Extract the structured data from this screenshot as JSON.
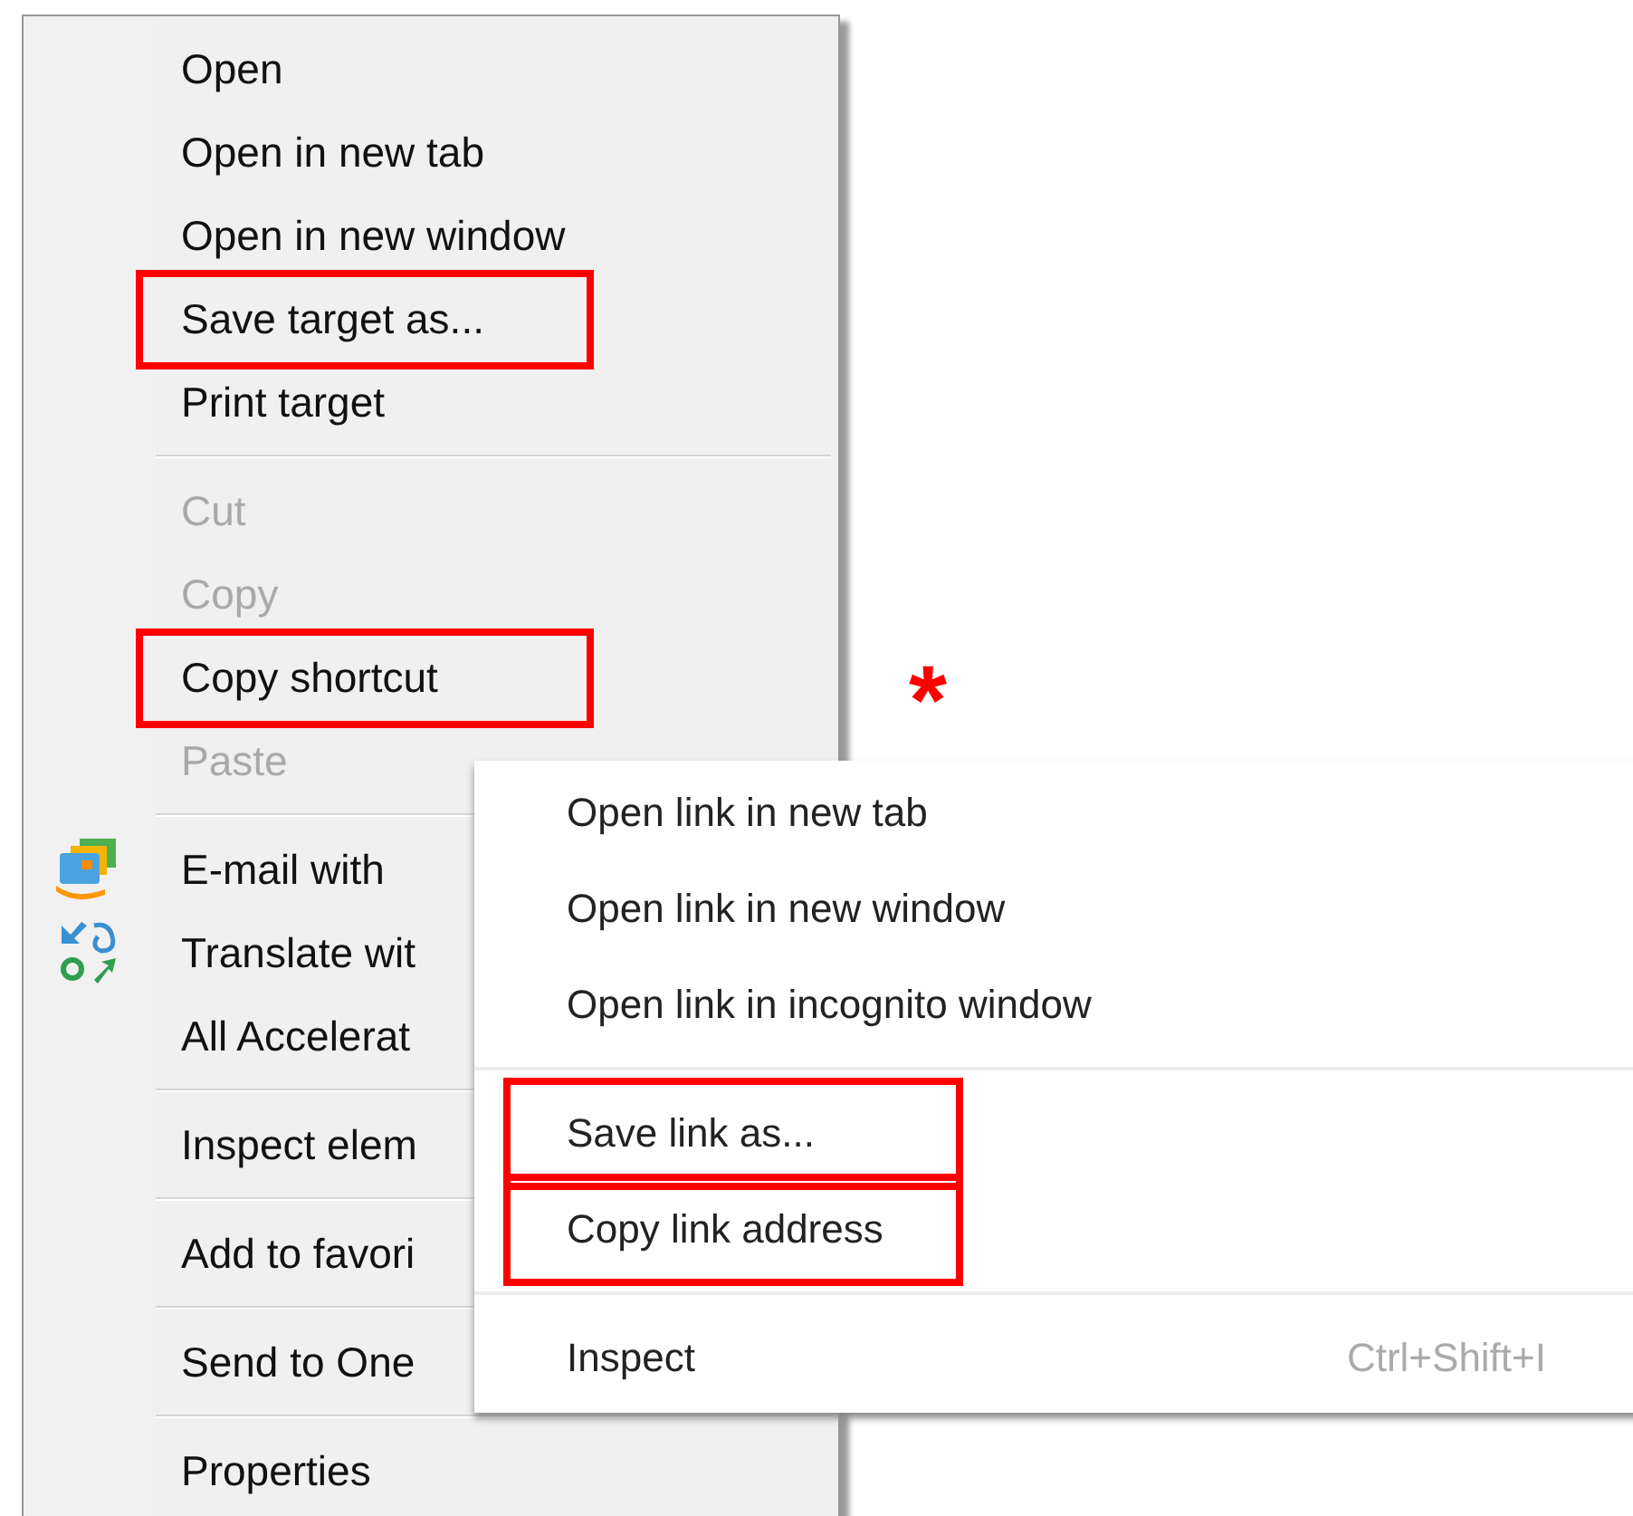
{
  "browser_menu": {
    "groups": [
      [
        {
          "label": "Open",
          "disabled": false,
          "highlighted": false
        },
        {
          "label": "Open in new tab",
          "disabled": false,
          "highlighted": false
        },
        {
          "label": "Open in new window",
          "disabled": false,
          "highlighted": false
        },
        {
          "label": "Save target as...",
          "disabled": false,
          "highlighted": true
        },
        {
          "label": "Print target",
          "disabled": false,
          "highlighted": false
        }
      ],
      [
        {
          "label": "Cut",
          "disabled": true,
          "highlighted": false
        },
        {
          "label": "Copy",
          "disabled": true,
          "highlighted": false
        },
        {
          "label": "Copy shortcut",
          "disabled": false,
          "highlighted": true
        },
        {
          "label": "Paste",
          "disabled": true,
          "highlighted": false
        }
      ],
      [
        {
          "label": "E-mail with",
          "disabled": false,
          "highlighted": false,
          "kind": "email"
        },
        {
          "label": "Translate wit",
          "disabled": false,
          "highlighted": false,
          "kind": "translate"
        },
        {
          "label": "All Accelerat",
          "disabled": false,
          "highlighted": false
        }
      ],
      [
        {
          "label": "Inspect elem",
          "disabled": false,
          "highlighted": false
        }
      ],
      [
        {
          "label": "Add to favori",
          "disabled": false,
          "highlighted": false
        }
      ],
      [
        {
          "label": "Send to One",
          "disabled": false,
          "highlighted": false
        }
      ],
      [
        {
          "label": "Properties",
          "disabled": false,
          "highlighted": false
        }
      ]
    ]
  },
  "annotation_mark": "*",
  "link_menu": {
    "groups": [
      [
        {
          "label": "Open link in new tab",
          "highlighted": false
        },
        {
          "label": "Open link in new window",
          "highlighted": false
        },
        {
          "label": "Open link in incognito window",
          "highlighted": false
        }
      ],
      [
        {
          "label": "Save link as...",
          "highlighted": true
        },
        {
          "label": "Copy link address",
          "highlighted": true
        }
      ],
      [
        {
          "label": "Inspect",
          "highlighted": false,
          "shortcut": "Ctrl+Shift+I"
        }
      ]
    ]
  }
}
